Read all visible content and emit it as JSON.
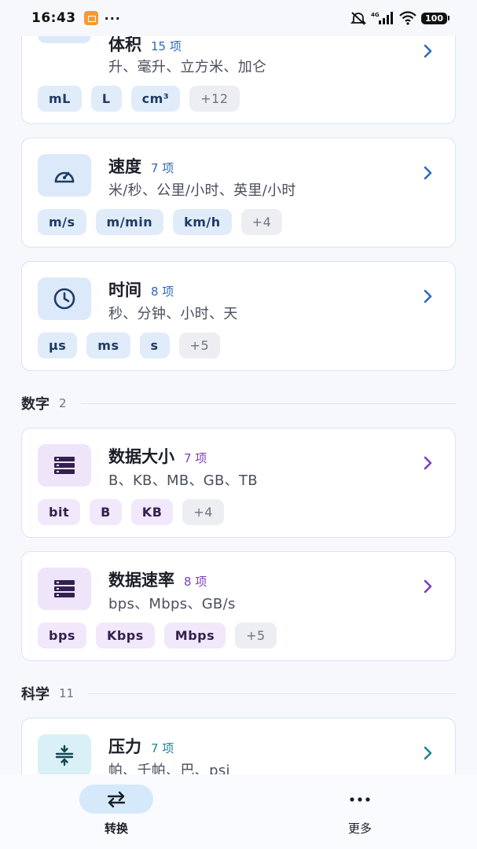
{
  "status_bar": {
    "time": "16:43",
    "dots": "···",
    "network": "4G",
    "battery": "100"
  },
  "cards": [
    {
      "title": "体积",
      "count": "15 项",
      "desc": "升、毫升、立方米、加仑",
      "chips": [
        "mL",
        "L",
        "cm³"
      ],
      "more": "+12",
      "icon": "archive-icon"
    },
    {
      "title": "速度",
      "count": "7 项",
      "desc": "米/秒、公里/小时、英里/小时",
      "chips": [
        "m/s",
        "m/min",
        "km/h"
      ],
      "more": "+4",
      "icon": "speedometer-icon"
    },
    {
      "title": "时间",
      "count": "8 项",
      "desc": "秒、分钟、小时、天",
      "chips": [
        "μs",
        "ms",
        "s"
      ],
      "more": "+5",
      "icon": "clock-icon"
    },
    {
      "title": "数据大小",
      "count": "7 项",
      "desc": "B、KB、MB、GB、TB",
      "chips": [
        "bit",
        "B",
        "KB"
      ],
      "more": "+4",
      "icon": "storage-icon"
    },
    {
      "title": "数据速率",
      "count": "8 项",
      "desc": "bps、Mbps、GB/s",
      "chips": [
        "bps",
        "Kbps",
        "Mbps"
      ],
      "more": "+5",
      "icon": "storage-icon"
    },
    {
      "title": "压力",
      "count": "7 项",
      "desc": "帕、千帕、巴、psi",
      "icon": "compress-icon"
    }
  ],
  "sections": [
    {
      "title": "数字",
      "count": "2"
    },
    {
      "title": "科学",
      "count": "11"
    }
  ],
  "bottom_nav": [
    {
      "label": "转换",
      "icon": "swap-icon",
      "active": true
    },
    {
      "label": "更多",
      "icon": "more-icon",
      "active": false
    }
  ],
  "colors": {
    "blue_accent": "#2f69b8",
    "purple_accent": "#7b3fb8",
    "teal_accent": "#1f8496"
  }
}
